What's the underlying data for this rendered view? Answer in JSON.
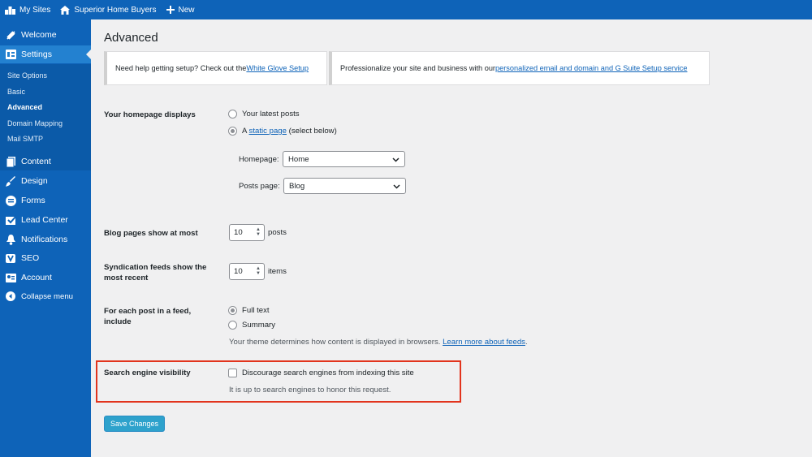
{
  "adminbar": {
    "my_sites": "My Sites",
    "site_name": "Superior Home Buyers",
    "new": "New"
  },
  "sidebar": {
    "welcome": "Welcome",
    "settings": "Settings",
    "submenu": [
      "Site Options",
      "Basic",
      "Advanced",
      "Domain Mapping",
      "Mail SMTP"
    ],
    "items": [
      "Content",
      "Design",
      "Forms",
      "Lead Center",
      "Notifications",
      "SEO",
      "Account",
      "Collapse menu"
    ]
  },
  "page_title": "Advanced",
  "notices": {
    "left_text": "Need help getting setup? Check out the ",
    "left_link": "White Glove Setup",
    "right_text": "Professionalize your site and business with our ",
    "right_link": "personalized email and domain and G Suite Setup service"
  },
  "homepage_displays": {
    "label": "Your homepage displays",
    "option_latest": "Your latest posts",
    "option_static_prefix": "A ",
    "option_static_link": "static page",
    "option_static_suffix": " (select below)",
    "selected": "static page",
    "homepage_label": "Homepage:",
    "homepage_value": "Home",
    "posts_page_label": "Posts page:",
    "posts_page_value": "Blog"
  },
  "blog_pages": {
    "label": "Blog pages show at most",
    "value": "10",
    "unit": "posts"
  },
  "syndication": {
    "label": "Syndication feeds show the most recent",
    "value": "10",
    "unit": "items"
  },
  "feed_include": {
    "label": "For each post in a feed, include",
    "option_full": "Full text",
    "option_summary": "Summary",
    "selected": "Full text",
    "help_text": "Your theme determines how content is displayed in browsers. ",
    "help_link": "Learn more about feeds",
    "help_suffix": "."
  },
  "search_visibility": {
    "label": "Search engine visibility",
    "checkbox_label": "Discourage search engines from indexing this site",
    "checked": false,
    "help": "It is up to search engines to honor this request."
  },
  "save_button": "Save Changes",
  "colors": {
    "admin_blue": "#0e63b8",
    "highlight_red": "#e2341d",
    "save_blue": "#2ea2cc"
  }
}
